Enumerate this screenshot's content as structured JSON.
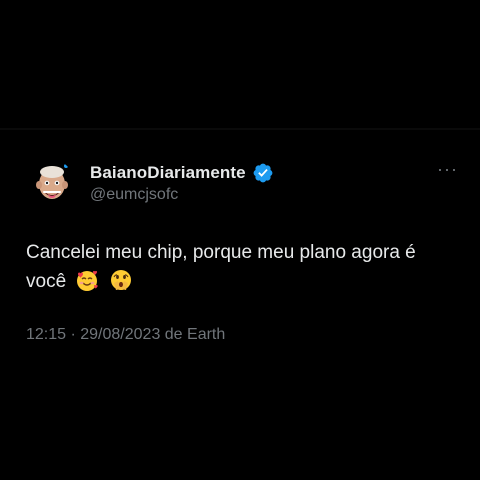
{
  "tweet": {
    "author": {
      "display_name": "BaianoDiariamente",
      "handle": "@eumcjsofc",
      "verified": true,
      "avatar_icon": "memoji-avatar"
    },
    "more_label": "···",
    "text": "Cancelei meu chip, porque meu plano agora é você",
    "emojis": [
      "smiling-face-with-hearts-icon",
      "face-with-open-eyes-and-hand-over-mouth-icon"
    ],
    "meta": "12:15 · 29/08/2023 de Earth"
  },
  "colors": {
    "background": "#000000",
    "text_primary": "#e7e9ea",
    "text_secondary": "#71767b",
    "verified": "#1d9bf0"
  }
}
